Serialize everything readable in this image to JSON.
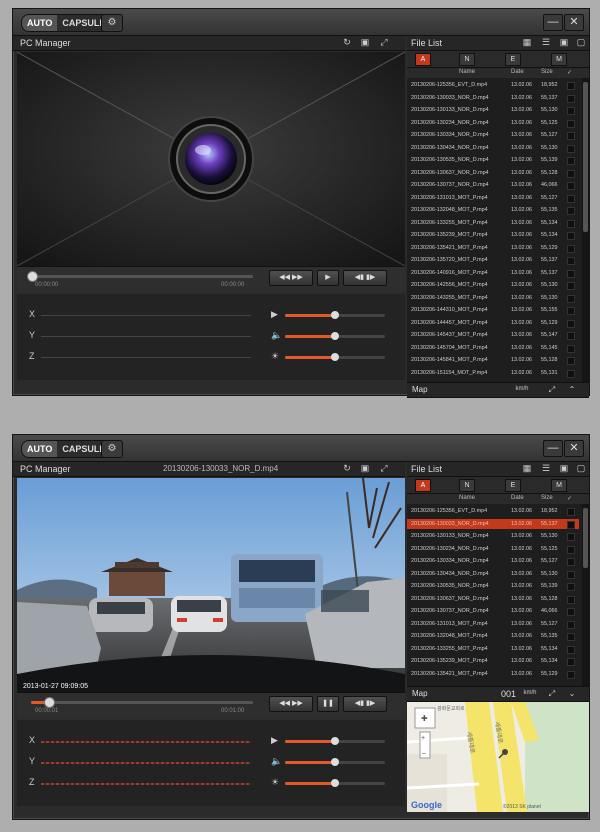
{
  "toolbar": {
    "auto": "AUTO",
    "capsule": "CAPSULE"
  },
  "panels": {
    "player_title": "PC Manager",
    "file_list_title": "File List",
    "map_title": "Map"
  },
  "file_tabs": [
    "A",
    "N",
    "E",
    "M"
  ],
  "columns": {
    "name": "Name",
    "date": "Date",
    "size": "Size"
  },
  "files": [
    {
      "name": "20130206-125356_EVT_D.mp4",
      "date": "13.02.06",
      "size": "18,952"
    },
    {
      "name": "20130206-130033_NOR_D.mp4",
      "date": "13.02.06",
      "size": "55,137"
    },
    {
      "name": "20130206-130133_NOR_D.mp4",
      "date": "13.02.06",
      "size": "55,130"
    },
    {
      "name": "20130206-130234_NOR_D.mp4",
      "date": "13.02.06",
      "size": "55,125"
    },
    {
      "name": "20130206-130334_NOR_D.mp4",
      "date": "13.02.06",
      "size": "55,127"
    },
    {
      "name": "20130206-130434_NOR_D.mp4",
      "date": "13.02.06",
      "size": "55,130"
    },
    {
      "name": "20130206-130535_NOR_D.mp4",
      "date": "13.02.06",
      "size": "55,139"
    },
    {
      "name": "20130206-130637_NOR_D.mp4",
      "date": "13.02.06",
      "size": "55,128"
    },
    {
      "name": "20130206-130737_NOR_D.mp4",
      "date": "13.02.06",
      "size": "46,066"
    },
    {
      "name": "20130206-131013_MOT_P.mp4",
      "date": "13.02.06",
      "size": "55,127"
    },
    {
      "name": "20130206-132048_MOT_P.mp4",
      "date": "13.02.06",
      "size": "55,135"
    },
    {
      "name": "20130206-133255_MOT_P.mp4",
      "date": "13.02.06",
      "size": "55,134"
    },
    {
      "name": "20130206-135239_MOT_P.mp4",
      "date": "13.02.06",
      "size": "55,134"
    },
    {
      "name": "20130206-135421_MOT_P.mp4",
      "date": "13.02.06",
      "size": "55,129"
    },
    {
      "name": "20130206-135720_MOT_P.mp4",
      "date": "13.02.06",
      "size": "55,137"
    },
    {
      "name": "20130206-140916_MOT_P.mp4",
      "date": "13.02.06",
      "size": "55,137"
    },
    {
      "name": "20130206-142556_MOT_P.mp4",
      "date": "13.02.06",
      "size": "55,130"
    },
    {
      "name": "20130206-143255_MOT_P.mp4",
      "date": "13.02.06",
      "size": "55,130"
    },
    {
      "name": "20130206-144310_MOT_P.mp4",
      "date": "13.02.06",
      "size": "55,155"
    },
    {
      "name": "20130206-144457_MOT_P.mp4",
      "date": "13.02.06",
      "size": "55,129"
    },
    {
      "name": "20130206-145437_MOT_P.mp4",
      "date": "13.02.06",
      "size": "55,147"
    },
    {
      "name": "20130206-145704_MOT_P.mp4",
      "date": "13.02.06",
      "size": "55,145"
    },
    {
      "name": "20130206-145841_MOT_P.mp4",
      "date": "13.02.06",
      "size": "55,128"
    },
    {
      "name": "20130206-151154_MOT_P.mp4",
      "date": "13.02.06",
      "size": "55,131"
    }
  ],
  "window1": {
    "time_start": "00:00:00",
    "time_end": "00:00:00",
    "map_unit": "km/h",
    "progress": 0
  },
  "window2": {
    "file_title": "20130206-130033_NOR_D.mp4",
    "video_timestamp": "2013-01-27  09:09:05",
    "time_start": "00:00:01",
    "time_end": "00:01:00",
    "speed": "001",
    "speed_unit": "km/h",
    "selected_file": 1,
    "progress": 0.03,
    "map_copyright": "©2013 SK planet",
    "map_brand": "Google"
  },
  "axes": [
    "X",
    "Y",
    "Z"
  ],
  "sliders": [
    0.5,
    0.5,
    0.5
  ],
  "colors": {
    "accent": "#e05a2a",
    "selected": "#c2391b",
    "panel": "#2b2b2b"
  }
}
